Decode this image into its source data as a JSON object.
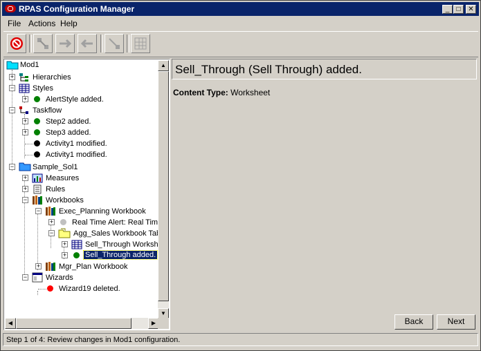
{
  "window": {
    "title": "RPAS Configuration Manager",
    "minimize_glyph": "_",
    "maximize_glyph": "□",
    "close_glyph": "✕"
  },
  "menu": {
    "file": "File",
    "actions": "Actions",
    "help": "Help"
  },
  "toolbar": {
    "buttons": [
      "stop-icon",
      "connect-icon",
      "move-right-icon",
      "move-left-icon",
      "link-icon",
      "grid-icon"
    ]
  },
  "tree": {
    "root": "Mod1",
    "hierarchies": "Hierarchies",
    "styles": "Styles",
    "alert_style": "AlertStyle added.",
    "taskflow": "Taskflow",
    "step2": "Step2 added.",
    "step3": "Step3 added.",
    "activity1_a": "Activity1 modified.",
    "activity1_b": "Activity1 modified.",
    "sample_sol1": "Sample_Sol1",
    "measures": "Measures",
    "rules": "Rules",
    "workbooks": "Workbooks",
    "exec_planning": "Exec_Planning Workbook",
    "real_time_alert": "Real Time Alert: Real Time",
    "agg_sales": "Agg_Sales Workbook Tab",
    "sell_through_ws": "Sell_Through Workshe",
    "sell_through_added": "Sell_Through added.",
    "mgr_plan": "Mgr_Plan Workbook",
    "wizards": "Wizards",
    "wizard19": "Wizard19 deleted."
  },
  "detail": {
    "header": "Sell_Through (Sell Through) added.",
    "content_type_label": "Content Type:",
    "content_type_value": "Worksheet"
  },
  "buttons": {
    "back": "Back",
    "next": "Next"
  },
  "status": {
    "text": "Step 1 of 4: Review changes in Mod1 configuration."
  },
  "colors": {
    "title_bar": "#0a246a",
    "added": "#008000",
    "modified": "#000000",
    "deleted": "#ff0000",
    "info": "#c0c0c0"
  }
}
